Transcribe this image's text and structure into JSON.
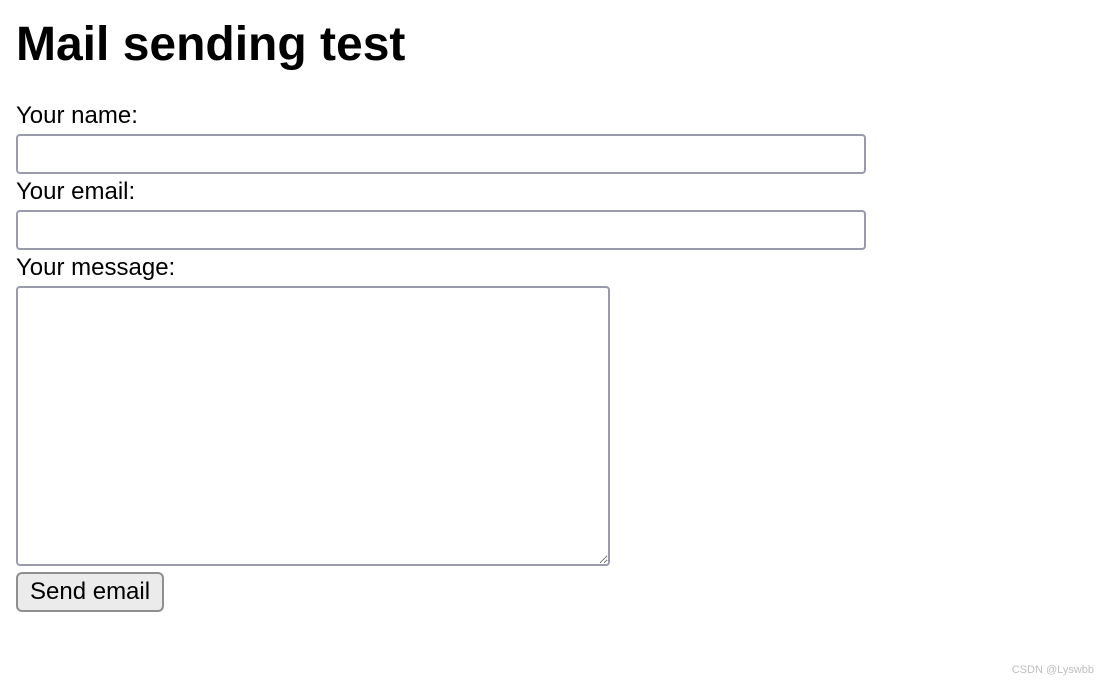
{
  "page": {
    "title": "Mail sending test"
  },
  "form": {
    "name_label": "Your name:",
    "name_value": "",
    "email_label": "Your email:",
    "email_value": "",
    "message_label": "Your message:",
    "message_value": "",
    "submit_label": "Send email"
  },
  "watermark": "CSDN @Lyswbb"
}
